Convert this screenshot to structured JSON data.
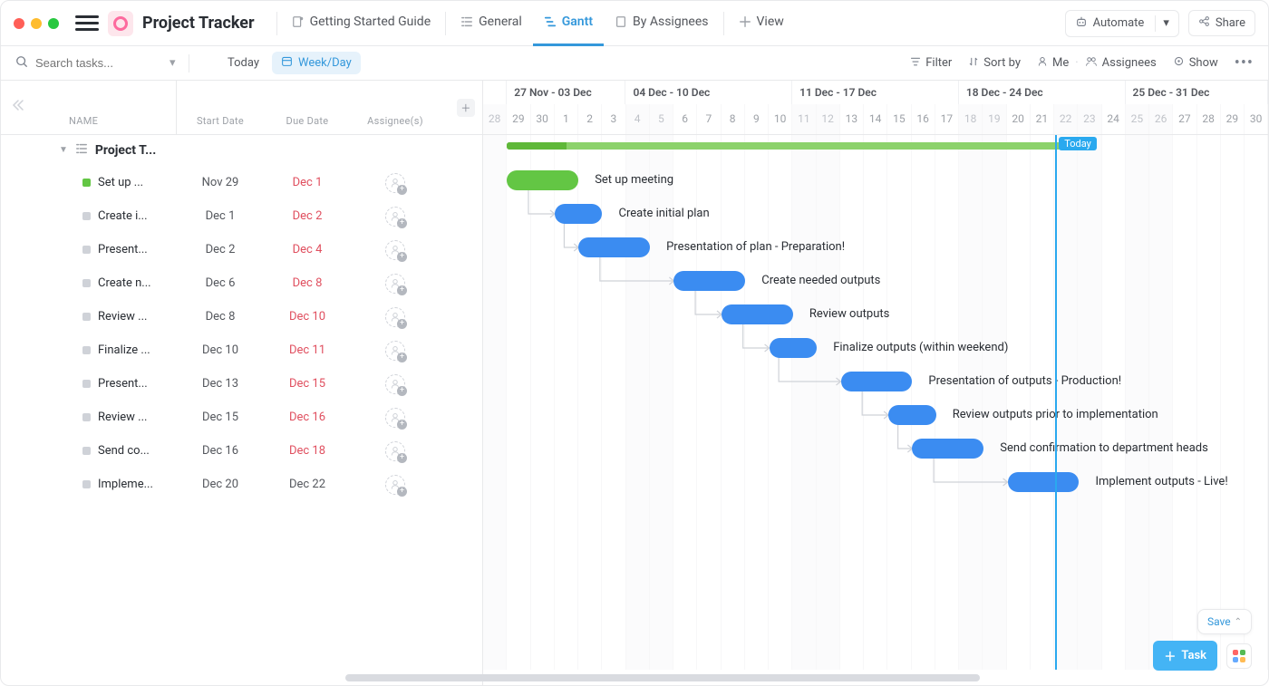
{
  "header": {
    "title": "Project Tracker",
    "tabs": [
      {
        "label": "Getting Started Guide",
        "icon": "doc-pin"
      },
      {
        "label": "General",
        "icon": "list"
      },
      {
        "label": "Gantt",
        "icon": "gantt",
        "active": true
      },
      {
        "label": "By Assignees",
        "icon": "doc"
      },
      {
        "label": "View",
        "icon": "plus"
      }
    ],
    "automate": "Automate",
    "share": "Share"
  },
  "toolbar": {
    "search_placeholder": "Search tasks...",
    "today": "Today",
    "time_unit": "Week/Day",
    "filter": "Filter",
    "sort_by": "Sort by",
    "me": "Me",
    "assignees": "Assignees",
    "show": "Show"
  },
  "columns": {
    "name": "NAME",
    "start": "Start Date",
    "due": "Due Date",
    "assign": "Assignee(s)"
  },
  "group": {
    "title": "Project T..."
  },
  "tasks": [
    {
      "name": "Set up ...",
      "start": "Nov 29",
      "due": "Dec 1",
      "due_style": "due-red",
      "status": "#63c644",
      "bar_start": 1,
      "bar_days": 3,
      "green": true,
      "label": "Set up meeting"
    },
    {
      "name": "Create i...",
      "start": "Dec 1",
      "due": "Dec 2",
      "due_style": "due-red",
      "status": "#cfd2d8",
      "bar_start": 3,
      "bar_days": 2,
      "green": false,
      "label": "Create initial plan"
    },
    {
      "name": "Present...",
      "start": "Dec 2",
      "due": "Dec 4",
      "due_style": "due-red",
      "status": "#cfd2d8",
      "bar_start": 4,
      "bar_days": 3,
      "green": false,
      "label": "Presentation of plan - Preparation!"
    },
    {
      "name": "Create n...",
      "start": "Dec 6",
      "due": "Dec 8",
      "due_style": "due-red",
      "status": "#cfd2d8",
      "bar_start": 8,
      "bar_days": 3,
      "green": false,
      "label": "Create needed outputs"
    },
    {
      "name": "Review ...",
      "start": "Dec 8",
      "due": "Dec 10",
      "due_style": "due-red",
      "status": "#cfd2d8",
      "bar_start": 10,
      "bar_days": 3,
      "green": false,
      "label": "Review outputs"
    },
    {
      "name": "Finalize ...",
      "start": "Dec 10",
      "due": "Dec 11",
      "due_style": "due-red",
      "status": "#cfd2d8",
      "bar_start": 12,
      "bar_days": 2,
      "green": false,
      "label": "Finalize outputs (within weekend)"
    },
    {
      "name": "Present...",
      "start": "Dec 13",
      "due": "Dec 15",
      "due_style": "due-red",
      "status": "#cfd2d8",
      "bar_start": 15,
      "bar_days": 3,
      "green": false,
      "label": "Presentation of outputs - Production!"
    },
    {
      "name": "Review ...",
      "start": "Dec 15",
      "due": "Dec 16",
      "due_style": "due-red",
      "status": "#cfd2d8",
      "bar_start": 17,
      "bar_days": 2,
      "green": false,
      "label": "Review outputs prior to implementation"
    },
    {
      "name": "Send co...",
      "start": "Dec 16",
      "due": "Dec 18",
      "due_style": "due-red",
      "status": "#cfd2d8",
      "bar_start": 18,
      "bar_days": 3,
      "green": false,
      "label": "Send confirmation to department heads"
    },
    {
      "name": "Impleme...",
      "start": "Dec 20",
      "due": "Dec 22",
      "due_style": "due-norm",
      "status": "#cfd2d8",
      "bar_start": 22,
      "bar_days": 3,
      "green": false,
      "label": "Implement outputs - Live!"
    }
  ],
  "timeline": {
    "day_width": 26.3,
    "today_index": 24,
    "today_label": "Today",
    "weeks": [
      {
        "span_days": 6,
        "label_short": ""
      },
      {
        "span_days": 7,
        "label_short": "04 Dec - 10 Dec",
        "prev_label": "27 Nov - 03 Dec"
      },
      {
        "span_days": 7,
        "label_short": "11 Dec - 17 Dec"
      },
      {
        "span_days": 7,
        "label_short": "18 Dec - 24 Dec"
      },
      {
        "span_days": 6,
        "label_short": "25 Dec - 31 Dec"
      }
    ],
    "week_labels": [
      "27 Nov - 03 Dec",
      "04 Dec - 10 Dec",
      "11 Dec - 17 Dec",
      "18 Dec - 24 Dec",
      "25 Dec - 31 Dec"
    ],
    "days": [
      {
        "n": "28",
        "we": true
      },
      {
        "n": "29",
        "we": false
      },
      {
        "n": "30",
        "we": false
      },
      {
        "n": "1",
        "we": false
      },
      {
        "n": "2",
        "we": false
      },
      {
        "n": "3",
        "we": false
      },
      {
        "n": "4",
        "we": true
      },
      {
        "n": "5",
        "we": true
      },
      {
        "n": "6",
        "we": false
      },
      {
        "n": "7",
        "we": false
      },
      {
        "n": "8",
        "we": false
      },
      {
        "n": "9",
        "we": false
      },
      {
        "n": "10",
        "we": false
      },
      {
        "n": "11",
        "we": true
      },
      {
        "n": "12",
        "we": true
      },
      {
        "n": "13",
        "we": false
      },
      {
        "n": "14",
        "we": false
      },
      {
        "n": "15",
        "we": false
      },
      {
        "n": "16",
        "we": false
      },
      {
        "n": "17",
        "we": false
      },
      {
        "n": "18",
        "we": true
      },
      {
        "n": "19",
        "we": true
      },
      {
        "n": "20",
        "we": false
      },
      {
        "n": "21",
        "we": false
      },
      {
        "n": "22",
        "we": true
      },
      {
        "n": "23",
        "we": true
      },
      {
        "n": "24",
        "we": false
      },
      {
        "n": "25",
        "we": true
      },
      {
        "n": "26",
        "we": true
      },
      {
        "n": "27",
        "we": false
      },
      {
        "n": "28",
        "we": false
      },
      {
        "n": "29",
        "we": false
      },
      {
        "n": "30",
        "we": false
      }
    ]
  },
  "group_bar": {
    "start_col": 1,
    "span_cols": 24,
    "fill_cols": 2.5
  },
  "footer": {
    "save": "Save",
    "task": "Task"
  },
  "chart_data": {
    "type": "gantt",
    "title": "Project Tracker",
    "x_axis": {
      "unit": "day",
      "start": "Nov 28",
      "end": "Dec 30",
      "today": "Dec 22"
    },
    "tasks": [
      {
        "name": "Set up meeting",
        "start": "Nov 29",
        "end": "Dec 1",
        "status": "done",
        "depends_on": null
      },
      {
        "name": "Create initial plan",
        "start": "Dec 1",
        "end": "Dec 2",
        "status": "open",
        "depends_on": "Set up meeting"
      },
      {
        "name": "Presentation of plan - Preparation!",
        "start": "Dec 2",
        "end": "Dec 4",
        "status": "open",
        "depends_on": "Create initial plan"
      },
      {
        "name": "Create needed outputs",
        "start": "Dec 6",
        "end": "Dec 8",
        "status": "open",
        "depends_on": "Presentation of plan - Preparation!"
      },
      {
        "name": "Review outputs",
        "start": "Dec 8",
        "end": "Dec 10",
        "status": "open",
        "depends_on": "Create needed outputs"
      },
      {
        "name": "Finalize outputs (within weekend)",
        "start": "Dec 10",
        "end": "Dec 11",
        "status": "open",
        "depends_on": "Review outputs"
      },
      {
        "name": "Presentation of outputs - Production!",
        "start": "Dec 13",
        "end": "Dec 15",
        "status": "open",
        "depends_on": "Finalize outputs (within weekend)"
      },
      {
        "name": "Review outputs prior to implementation",
        "start": "Dec 15",
        "end": "Dec 16",
        "status": "open",
        "depends_on": "Presentation of outputs - Production!"
      },
      {
        "name": "Send confirmation to department heads",
        "start": "Dec 16",
        "end": "Dec 18",
        "status": "open",
        "depends_on": "Review outputs prior to implementation"
      },
      {
        "name": "Implement outputs - Live!",
        "start": "Dec 20",
        "end": "Dec 22",
        "status": "open",
        "depends_on": "Send confirmation to department heads"
      }
    ]
  }
}
